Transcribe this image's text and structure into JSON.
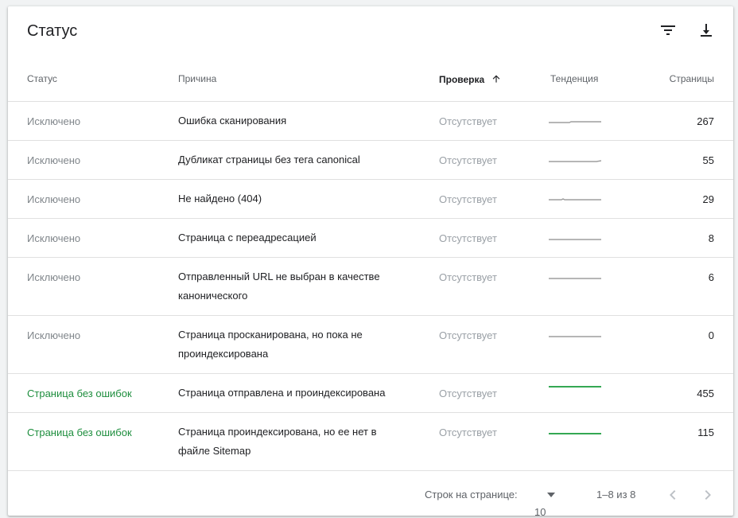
{
  "card": {
    "title": "Статус",
    "icons": {
      "filter": "filter-list-icon",
      "download": "download-icon"
    }
  },
  "columns": {
    "status": "Статус",
    "reason": "Причина",
    "check": "Проверка",
    "trend": "Тенденция",
    "pages": "Страницы"
  },
  "colors": {
    "ok": "#1e8e3e",
    "excluded": "#80868b",
    "trend_grey": "#9e9e9e",
    "trend_green": "#34a853"
  },
  "rows": [
    {
      "status": "Исключено",
      "reason": "Ошибка сканирования",
      "check": "Отсутствует",
      "pages": "267",
      "ok": false
    },
    {
      "status": "Исключено",
      "reason": "Дубликат страницы без тега canonical",
      "check": "Отсутствует",
      "pages": "55",
      "ok": false
    },
    {
      "status": "Исключено",
      "reason": "Не найдено (404)",
      "check": "Отсутствует",
      "pages": "29",
      "ok": false
    },
    {
      "status": "Исключено",
      "reason": "Страница с переадресацией",
      "check": "Отсутствует",
      "pages": "8",
      "ok": false
    },
    {
      "status": "Исключено",
      "reason": "Отправленный URL не выбран в качестве канонического",
      "check": "Отсутствует",
      "pages": "6",
      "ok": false
    },
    {
      "status": "Исключено",
      "reason": "Страница просканирована, но пока не проиндексирована",
      "check": "Отсутствует",
      "pages": "0",
      "ok": false
    },
    {
      "status": "Страница без ошибок",
      "reason": "Страница отправлена и проиндексирована",
      "check": "Отсутствует",
      "pages": "455",
      "ok": true
    },
    {
      "status": "Страница без ошибок",
      "reason": "Страница проиндексирована, но ее нет в файле Sitemap",
      "check": "Отсутствует",
      "pages": "115",
      "ok": true
    }
  ],
  "footer": {
    "rows_per_page_label": "Строк на странице:",
    "rows_per_page_value": "10",
    "range": "1–8 из 8"
  }
}
